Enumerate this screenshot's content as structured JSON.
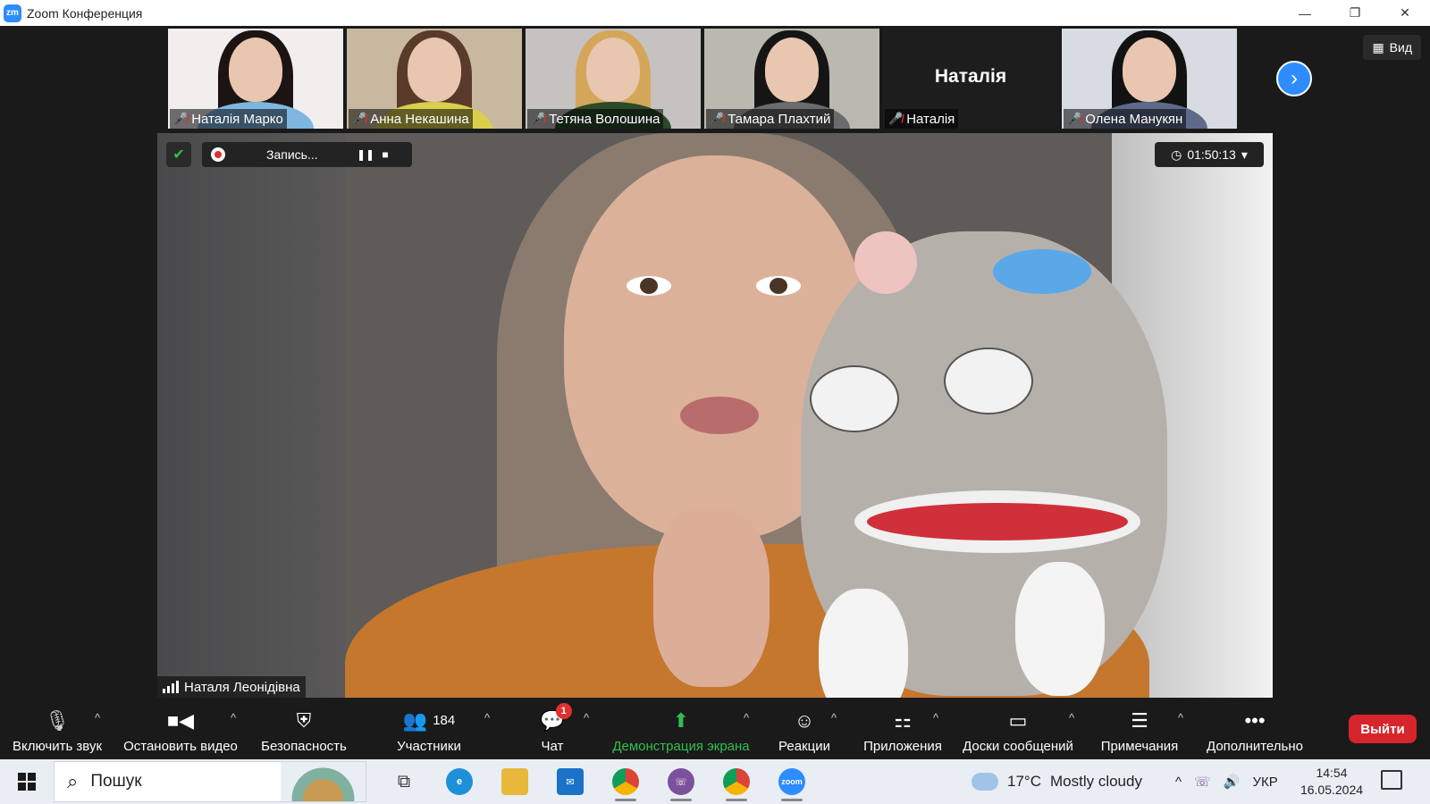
{
  "window": {
    "logo_text": "zm",
    "title": "Zoom Конференция",
    "controls": [
      "—",
      "❐",
      "✕"
    ]
  },
  "participants": [
    {
      "name": "Наталія Марко",
      "mic": "muted",
      "hair": "#1c1412",
      "shirt": "#7fb6e0",
      "bg": "#f2eeee"
    },
    {
      "name": "Анна Некашина",
      "mic": "muted",
      "hair": "#5a3a2a",
      "shirt": "#d9cf4c",
      "bg": "#c8b8a0"
    },
    {
      "name": "Тетяна Волошина",
      "mic": "muted",
      "hair": "#d3a65a",
      "shirt": "#2a4a2a",
      "bg": "#c6c2c2"
    },
    {
      "name": "Тамара Плахтий",
      "mic": "muted",
      "hair": "#151515",
      "shirt": "#6b6b6b",
      "bg": "#b9b9b0"
    },
    {
      "name": "Наталія",
      "mic": "muted",
      "display_text": "Наталія"
    },
    {
      "name": "Олена Манукян",
      "mic": "muted",
      "hair": "#121212",
      "shirt": "#5d6a8a",
      "bg": "#d8dce2"
    }
  ],
  "view_button": "Вид",
  "recording": {
    "label": "Запись...",
    "pause_icon": "pause-icon",
    "stop_icon": "stop-icon"
  },
  "timer": "01:50:13",
  "speaker": {
    "name": "Наталя Леонідівна"
  },
  "toolbar": {
    "mute": "Включить звук",
    "video": "Остановить видео",
    "security": "Безопасность",
    "participants": "Участники",
    "participants_count": "184",
    "chat": "Чат",
    "chat_badge": "1",
    "share": "Демонстрация экрана",
    "reactions": "Реакции",
    "apps": "Приложения",
    "whiteboards": "Доски сообщений",
    "notes": "Примечания",
    "more": "Дополнительно",
    "leave": "Выйти"
  },
  "taskbar": {
    "search_placeholder": "Пошук",
    "weather_temp": "17°C",
    "weather_desc": "Mostly cloudy",
    "lang": "УКР",
    "time": "14:54",
    "date": "16.05.2024",
    "apps": [
      "task-view",
      "edge",
      "file-explorer",
      "mail",
      "chrome",
      "viber",
      "chrome",
      "zoom"
    ]
  },
  "colors": {
    "accent": "#2d8cff",
    "leave": "#d6252b",
    "share": "#2fbf4f",
    "mute": "#e0302d"
  }
}
